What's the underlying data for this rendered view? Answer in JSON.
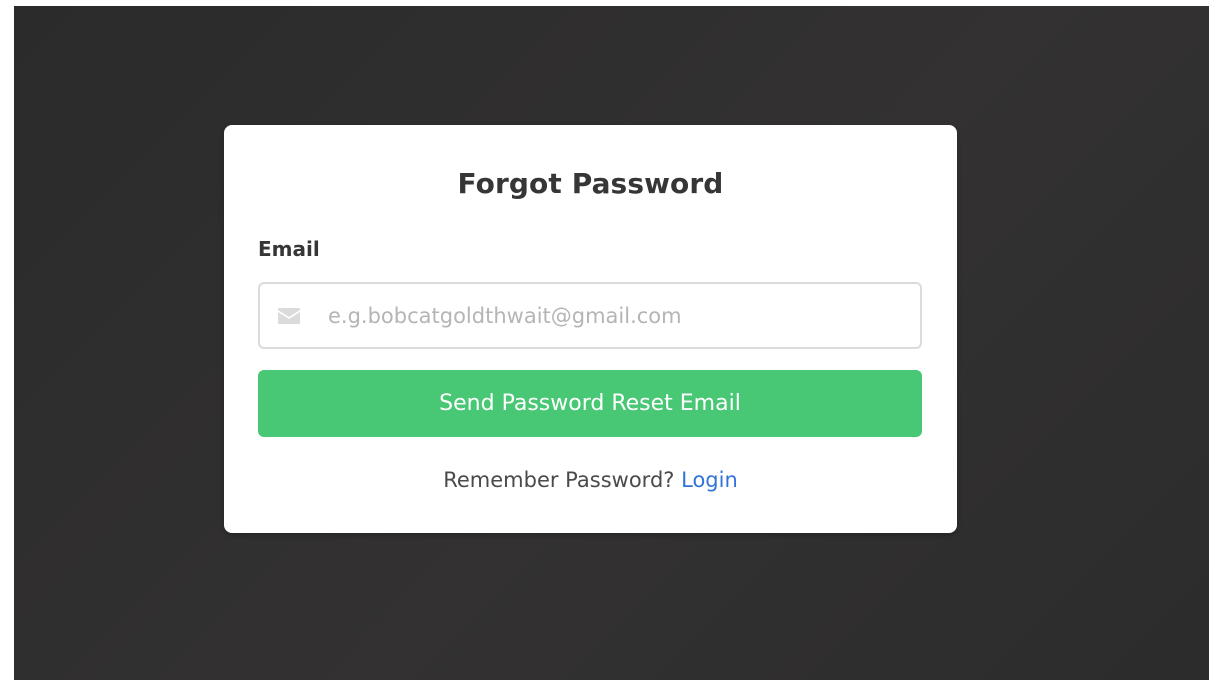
{
  "form": {
    "title": "Forgot Password",
    "email_label": "Email",
    "email_value": "",
    "email_placeholder": "e.g.bobcatgoldthwait@gmail.com",
    "email_icon": "envelope-icon",
    "submit_label": "Send Password Reset Email",
    "remember_text": "Remember Password?",
    "login_link_label": "Login"
  },
  "colors": {
    "primary_button": "#48c774",
    "link": "#3273dc",
    "background": "#2e2d2d",
    "card": "#ffffff"
  }
}
